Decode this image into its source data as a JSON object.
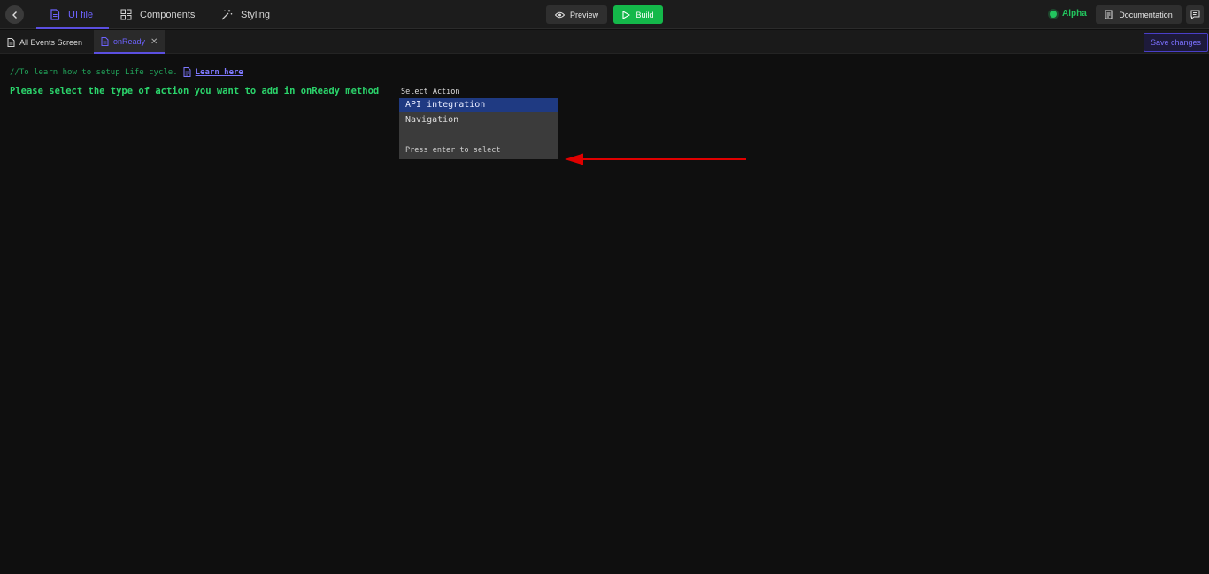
{
  "topbar": {
    "tabs": [
      {
        "label": "UI file",
        "icon": "file-icon",
        "active": true
      },
      {
        "label": "Components",
        "icon": "grid-icon",
        "active": false
      },
      {
        "label": "Styling",
        "icon": "magic-wand-icon",
        "active": false
      }
    ],
    "preview_label": "Preview",
    "build_label": "Build",
    "status_label": "Alpha",
    "docs_label": "Documentation"
  },
  "filebar": {
    "tabs": [
      {
        "label": "All Events Screen",
        "icon": "file-icon",
        "active": false
      },
      {
        "label": "onReady",
        "icon": "file-icon",
        "active": true
      }
    ],
    "save_label": "Save changes"
  },
  "editor": {
    "comment": "//To learn how to setup Life cycle.",
    "learn_link": "Learn here",
    "prompt": "Please select the type of action you want to add in onReady method",
    "select_label": "Select Action",
    "options": [
      "API integration",
      "Navigation"
    ],
    "selected_index": 0,
    "hint": "Press enter to select"
  },
  "colors": {
    "accent": "#5b4fe0",
    "build_green": "#14b84a",
    "code_green": "#2bd46b",
    "selection": "#1f3a82",
    "arrow": "#e00000"
  }
}
